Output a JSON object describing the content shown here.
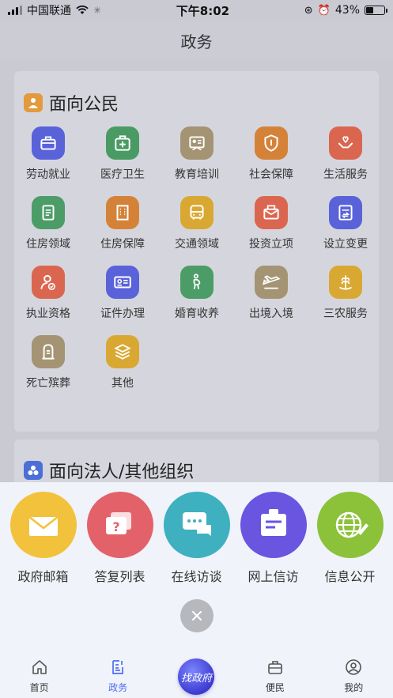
{
  "status_bar": {
    "carrier": "中国联通",
    "time": "下午8:02",
    "battery": "43%"
  },
  "nav": {
    "title": "政务"
  },
  "citizen": {
    "title": "面向公民",
    "services": [
      {
        "label": "劳动就业",
        "color": "#5a62d9",
        "icon": "briefcase-icon"
      },
      {
        "label": "医疗卫生",
        "color": "#4a9a64",
        "icon": "medical-kit-icon"
      },
      {
        "label": "教育培训",
        "color": "#a49474",
        "icon": "whiteboard-icon"
      },
      {
        "label": "社会保障",
        "color": "#d58239",
        "icon": "shield-icon"
      },
      {
        "label": "生活服务",
        "color": "#db6650",
        "icon": "hands-heart-icon"
      },
      {
        "label": "住房领域",
        "color": "#4c9c68",
        "icon": "house-document-icon"
      },
      {
        "label": "住房保障",
        "color": "#d58239",
        "icon": "building-icon"
      },
      {
        "label": "交通领域",
        "color": "#d9a832",
        "icon": "bus-icon"
      },
      {
        "label": "投资立项",
        "color": "#db6650",
        "icon": "mail-icon"
      },
      {
        "label": "设立变更",
        "color": "#5a62d9",
        "icon": "document-swap-icon"
      },
      {
        "label": "执业资格",
        "color": "#db6650",
        "icon": "user-check-icon"
      },
      {
        "label": "证件办理",
        "color": "#5a62d9",
        "icon": "id-card-icon"
      },
      {
        "label": "婚育收养",
        "color": "#4c9c68",
        "icon": "pregnant-icon"
      },
      {
        "label": "出境入境",
        "color": "#a49474",
        "icon": "airplane-icon"
      },
      {
        "label": "三农服务",
        "color": "#d9a832",
        "icon": "wheat-icon"
      },
      {
        "label": "死亡殡葬",
        "color": "#a49474",
        "icon": "tombstone-icon"
      },
      {
        "label": "其他",
        "color": "#d9a832",
        "icon": "layers-icon"
      }
    ]
  },
  "org": {
    "title": "面向法人/其他组织"
  },
  "quick_actions": [
    {
      "label": "政府邮箱",
      "color": "#f3c23c",
      "icon": "envelope-icon"
    },
    {
      "label": "答复列表",
      "color": "#e3626a",
      "icon": "question-chat-icon"
    },
    {
      "label": "在线访谈",
      "color": "#3eb0c0",
      "icon": "chat-bubbles-icon"
    },
    {
      "label": "网上信访",
      "color": "#6a55e0",
      "icon": "letter-icon"
    },
    {
      "label": "信息公开",
      "color": "#8cc23a",
      "icon": "globe-pen-icon"
    }
  ],
  "tabs": [
    {
      "label": "首页",
      "icon": "home-icon"
    },
    {
      "label": "政务",
      "icon": "government-icon"
    },
    {
      "label": "找政府",
      "icon": "find-government-icon"
    },
    {
      "label": "便民",
      "icon": "toolbox-icon"
    },
    {
      "label": "我的",
      "icon": "profile-icon"
    }
  ],
  "colors": {
    "accent": "#4e6ef2",
    "overlay_background": "#c9cad2",
    "sheet_background": "#f0f3fa"
  }
}
